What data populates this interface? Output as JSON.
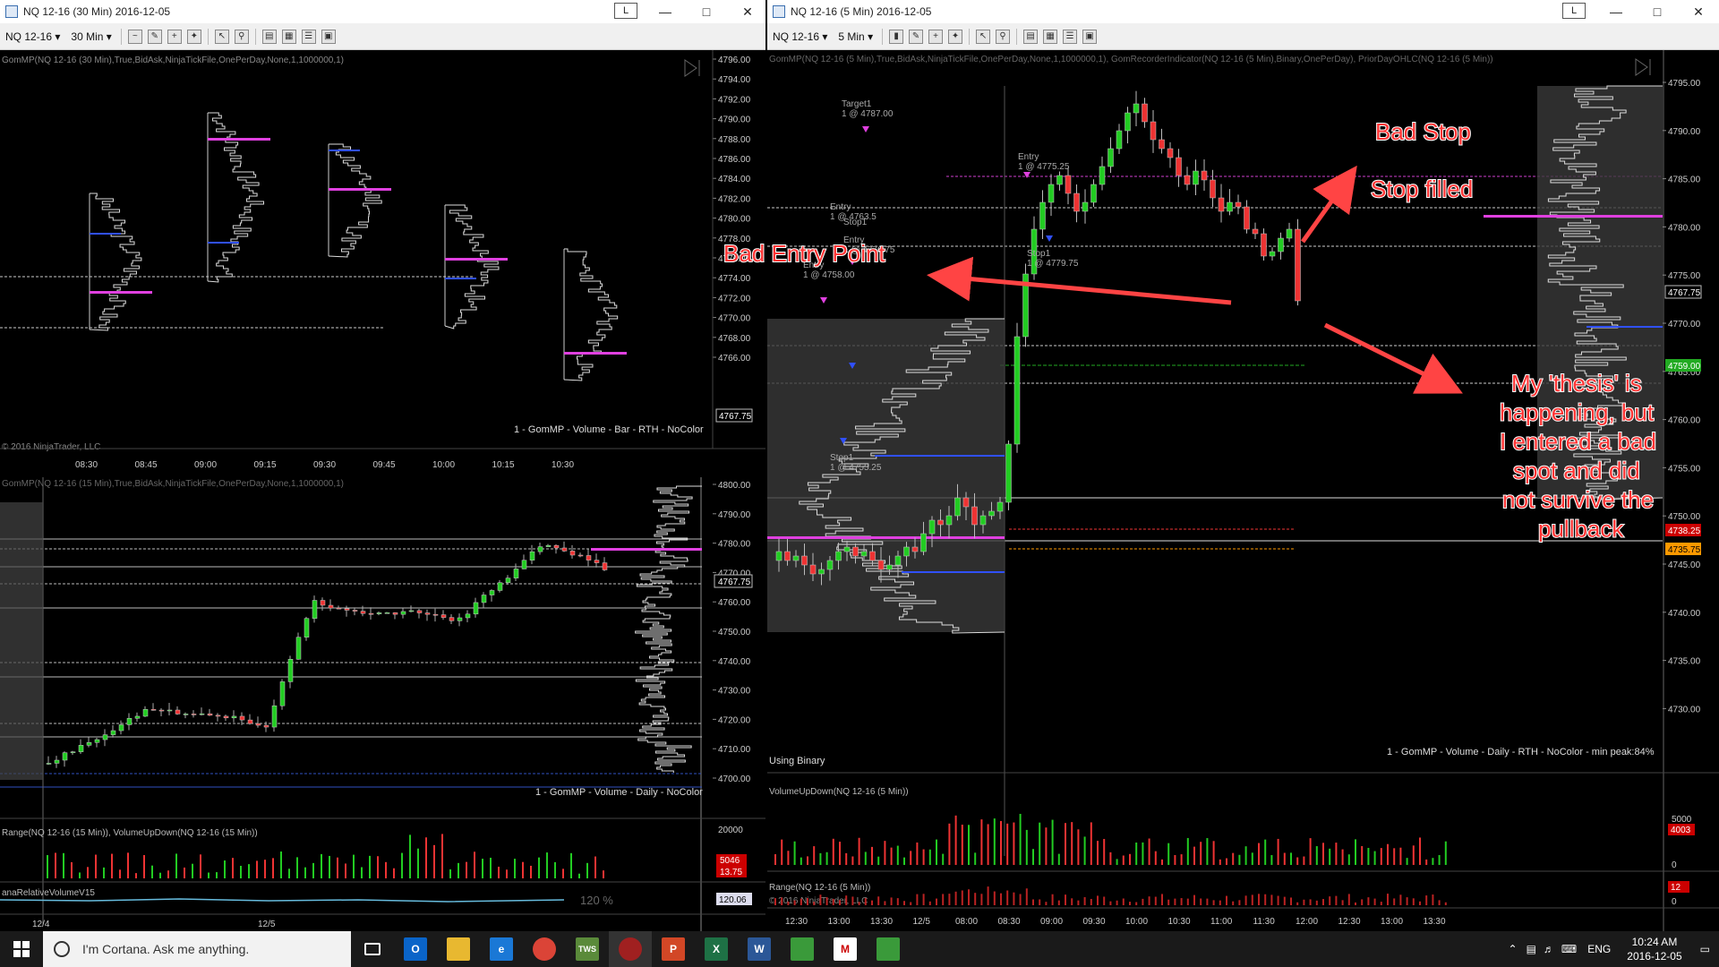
{
  "left_top": {
    "title": "NQ 12-16 (30 Min)  2016-12-05",
    "instrument": "NQ 12-16",
    "period": "30 Min",
    "indicator_label": "GomMP(NQ 12-16 (30 Min),True,BidAsk,NinjaTickFile,OnePerDay,None,1,1000000,1)",
    "footer_label": "1 - GomMP - Volume - Bar - RTH - NoColor",
    "copyright": "© 2016 NinjaTrader, LLC",
    "price_badge": "4767.75",
    "y_labels": [
      "4796.00",
      "4794.00",
      "4792.00",
      "4790.00",
      "4788.00",
      "4786.00",
      "4784.00",
      "4782.00",
      "4780.00",
      "4778.00",
      "4776.00",
      "4774.00",
      "4772.00",
      "4770.00",
      "4768.00",
      "4766.00"
    ],
    "x_labels": [
      "08:30",
      "08:45",
      "09:00",
      "09:15",
      "09:30",
      "09:45",
      "10:00",
      "10:15",
      "10:30"
    ]
  },
  "left_bottom": {
    "indicator_label": "GomMP(NQ 12-16 (15 Min),True,BidAsk,NinjaTickFile,OnePerDay,None,1,1000000,1)",
    "footer_label": "1 - GomMP - Volume - Daily - NoColor",
    "price_badge": "4767.75",
    "y_labels": [
      "4800.00",
      "4790.00",
      "4780.00",
      "4770.00",
      "4760.00",
      "4750.00",
      "4740.00",
      "4730.00",
      "4720.00",
      "4710.00",
      "4700.00"
    ],
    "sub1_label": "Range(NQ 12-16 (15 Min)), VolumeUpDown(NQ 12-16 (15 Min))",
    "sub1_y": "20000",
    "sub1_badge1": "5046",
    "sub1_badge2": "13.75",
    "sub2_label": "anaRelativeVolumeV15",
    "sub2_pct": "120 %",
    "sub2_badge": "120.06",
    "x_labels": [
      "12/4",
      "12/5"
    ]
  },
  "right": {
    "title": "NQ 12-16 (5 Min)  2016-12-05",
    "instrument": "NQ 12-16",
    "period": "5 Min",
    "indicator_label": "GomMP(NQ 12-16 (5 Min),True,BidAsk,NinjaTickFile,OnePerDay,None,1,1000000,1), GomRecorderIndicator(NQ 12-16 (5 Min),Binary,OnePerDay), PriorDayOHLC(NQ 12-16 (5 Min))",
    "footer_label": "1 - GomMP - Volume - Daily - RTH - NoColor - min peak:84%",
    "using_binary": "Using Binary",
    "y_labels": [
      "4795.00",
      "4790.00",
      "4785.00",
      "4780.00",
      "4775.00",
      "4770.00",
      "4765.00",
      "4760.00",
      "4755.00",
      "4750.00",
      "4745.00",
      "4740.00",
      "4735.00",
      "4730.00"
    ],
    "badges": {
      "last": "4767.75",
      "green": "4759.00",
      "red": "4738.25",
      "orange": "4735.75"
    },
    "sub1_label": "VolumeUpDown(NQ 12-16 (5 Min))",
    "sub1_y": [
      "5000",
      "0"
    ],
    "sub1_badge": "4003",
    "sub2_label": "Range(NQ 12-16 (5 Min))",
    "sub2_copyright": "© 2016 NinjaTrader, LLC",
    "sub2_y": "0",
    "sub2_badge": "12",
    "x_labels": [
      "12:30",
      "13:00",
      "13:30",
      "12/5",
      "08:00",
      "08:30",
      "09:00",
      "09:30",
      "10:00",
      "10:30",
      "11:00",
      "11:30",
      "12:00",
      "12:30",
      "13:00",
      "13:30"
    ],
    "orders": {
      "target1": [
        "Target1",
        "1 @ 4787.00"
      ],
      "entry1": [
        "Entry",
        "1 @ 4758.00"
      ],
      "entry2": [
        "Entry",
        "1 @ 4763.5"
      ],
      "stop2": [
        "Stop1"
      ],
      "entry3": [
        "Entry",
        "1 @ 4776.75"
      ],
      "stop1": [
        "Stop1",
        "1 @ 4755.25"
      ],
      "entry4": [
        "Entry",
        "1 @ 4775.25"
      ],
      "stop3": [
        "Stop1",
        "1 @ 4779.75"
      ]
    }
  },
  "annotations": {
    "bad_entry": "Bad Entry Point",
    "bad_stop": "Bad Stop",
    "stop_filled": "Stop filled",
    "thesis": [
      "My 'thesis' is",
      "happening, but",
      "I entered a bad",
      "spot and did",
      "not survive the",
      "pullback"
    ]
  },
  "taskbar": {
    "cortana": "I'm Cortana. Ask me anything.",
    "lang": "ENG",
    "time": "10:24 AM",
    "date": "2016-12-05"
  }
}
